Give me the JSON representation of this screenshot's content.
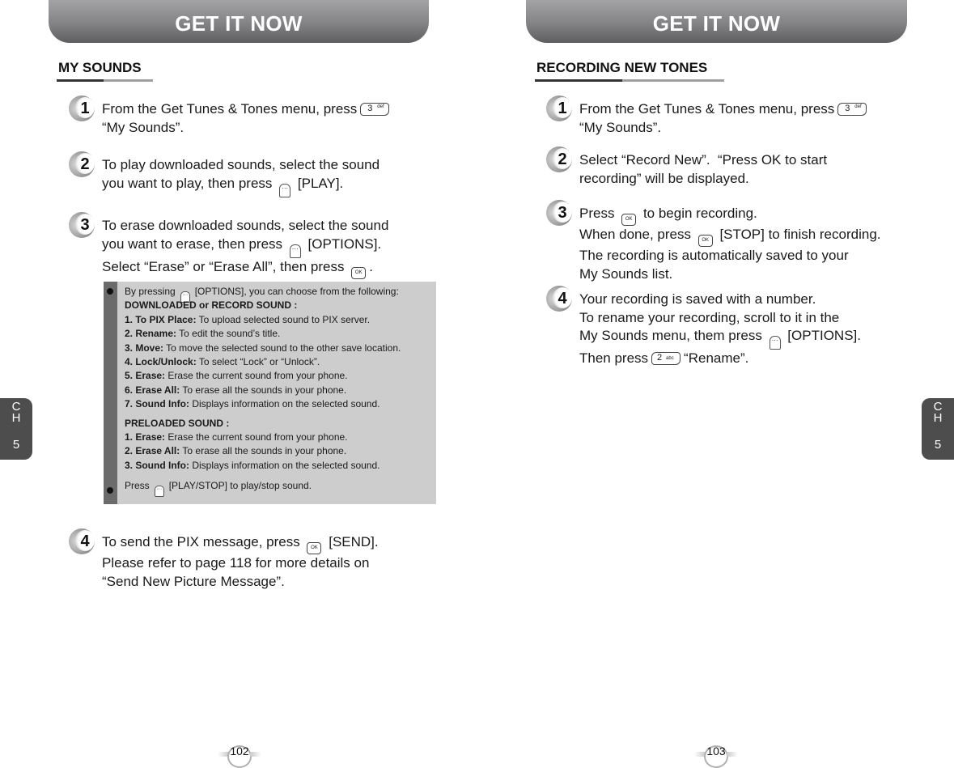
{
  "left_page": {
    "header": "GET IT NOW",
    "section_title": "MY SOUNDS",
    "steps": [
      {
        "number": "1",
        "line1_before": "From the Get Tunes & Tones menu, press",
        "key": "3-def-key",
        "line2": "“My Sounds”."
      },
      {
        "number": "2",
        "line1": "To play downloaded sounds, select the sound",
        "line2_before": "you want to play, then press",
        "key": "right-soft-key",
        "line2_after": "[PLAY]."
      },
      {
        "number": "3",
        "line1": "To erase downloaded sounds, select the sound",
        "line2_before": "you want to erase, then press",
        "key2": "left-soft-key",
        "line2_after": "[OPTIONS].",
        "line3_before": "Select “Erase” or “Erase All”, then press",
        "key3": "ok-key",
        "line3_after": "."
      },
      {
        "number": "4",
        "line1_before": "To send the PIX message, press",
        "key": "ok-key",
        "line1_after": "[SEND].",
        "line2": "Please refer to page 118 for more details on",
        "line3": "“Send New Picture Message”."
      }
    ],
    "note": {
      "intro_before": "By pressing",
      "intro_after": "[OPTIONS], you can choose from the following:",
      "downloaded_heading": "DOWNLOADED or RECORD SOUND :",
      "downloaded_items": [
        {
          "label": "1. To PIX Place:",
          "text": "To upload selected sound to PIX server."
        },
        {
          "label": "2. Rename:",
          "text": "To edit the sound’s title."
        },
        {
          "label": "3. Move:",
          "text": "To move the selected sound to the other save location."
        },
        {
          "label": "4. Lock/Unlock:",
          "text": "To select “Lock” or “Unlock”."
        },
        {
          "label": "5. Erase:",
          "text": "Erase the current sound from your phone."
        },
        {
          "label": "6. Erase All:",
          "text": "To erase all the sounds in your phone."
        },
        {
          "label": "7. Sound Info:",
          "text": "Displays information on the selected sound."
        }
      ],
      "preloaded_heading": "PRELOADED SOUND :",
      "preloaded_items": [
        {
          "label": "1. Erase:",
          "text": "Erase the current sound from your phone."
        },
        {
          "label": "2. Erase All:",
          "text": "To erase all the sounds in your phone."
        },
        {
          "label": "3. Sound Info:",
          "text": "Displays information on the selected sound."
        }
      ],
      "play_before": "Press",
      "play_after": "[PLAY/STOP] to play/stop sound."
    },
    "chapter_tab": {
      "c": "C",
      "h": "H",
      "n": "5"
    },
    "page_number": "102"
  },
  "right_page": {
    "header": "GET IT NOW",
    "section_title": "RECORDING NEW TONES",
    "steps": [
      {
        "number": "1",
        "line1_before": "From the Get Tunes & Tones menu, press",
        "key": "3-def-key",
        "line2": "“My Sounds”."
      },
      {
        "number": "2",
        "line1": "Select “Record New”.  “Press OK to start",
        "line2": "recording” will be displayed."
      },
      {
        "number": "3",
        "line1_before": "Press",
        "line1_after": "to begin recording.",
        "line2_before": "When done, press",
        "line2_after": "[STOP] to finish recording.",
        "line3": "The recording is automatically saved to your",
        "line4": "My Sounds list."
      },
      {
        "number": "4",
        "line1": "Your recording is saved with a number.",
        "line2": "To rename your recording, scroll to it in the",
        "line3_before": "My Sounds menu, them press",
        "line3_after": "[OPTIONS].",
        "line4_before": "Then press",
        "line4_after": "“Rename”."
      }
    ],
    "chapter_tab": {
      "c": "C",
      "h": "H",
      "n": "5"
    },
    "page_number": "103"
  },
  "keys": {
    "three_digit": "3",
    "three_letters": "def",
    "two_digit": "2",
    "two_letters": "abc",
    "ok": "OK",
    "soft": "···"
  }
}
